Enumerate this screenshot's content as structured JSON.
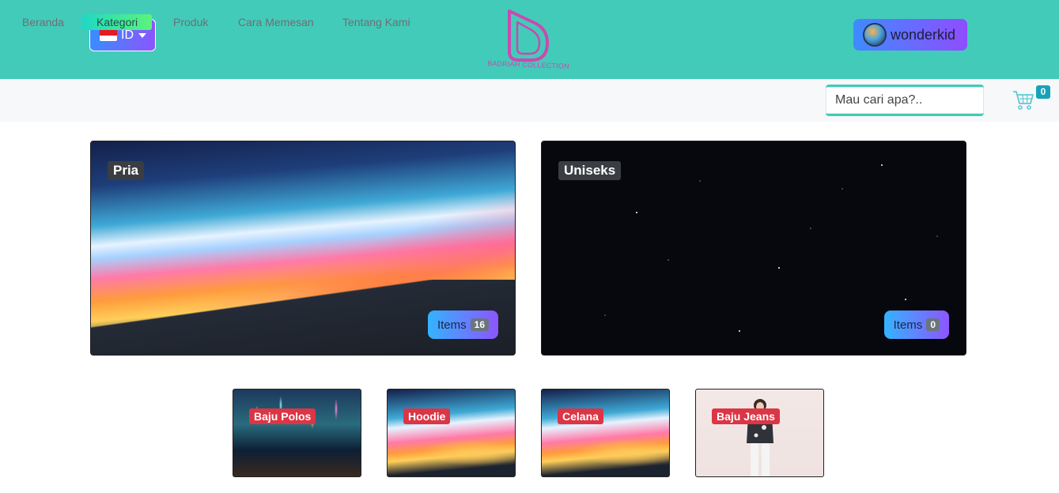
{
  "header": {
    "language": {
      "code": "ID",
      "flag_icon": "indonesia-flag-icon"
    },
    "logo_text": "BADRIAH COLLECTION",
    "user": {
      "name": "wonderkid"
    }
  },
  "nav": {
    "items": [
      {
        "label": "Beranda"
      },
      {
        "label": "Kategori",
        "active": true
      },
      {
        "label": "Produk"
      },
      {
        "label": "Cara Memesan"
      },
      {
        "label": "Tentang Kami"
      }
    ],
    "search_placeholder": "Mau cari apa?..",
    "cart_count": "0"
  },
  "categories": [
    {
      "title": "Pria",
      "items_label": "Items",
      "count": "16"
    },
    {
      "title": "Uniseks",
      "items_label": "Items",
      "count": "0"
    }
  ],
  "subcategories": [
    {
      "label": "Baju Polos"
    },
    {
      "label": "Hoodie"
    },
    {
      "label": "Celana"
    },
    {
      "label": "Baju Jeans"
    }
  ],
  "colors": {
    "header_bg": "#43cbb9",
    "accent_gradient_start": "#3a8dff",
    "accent_gradient_end": "#8b55ff",
    "badge_red": "#dc3545",
    "cart_badge": "#17a2b8"
  }
}
